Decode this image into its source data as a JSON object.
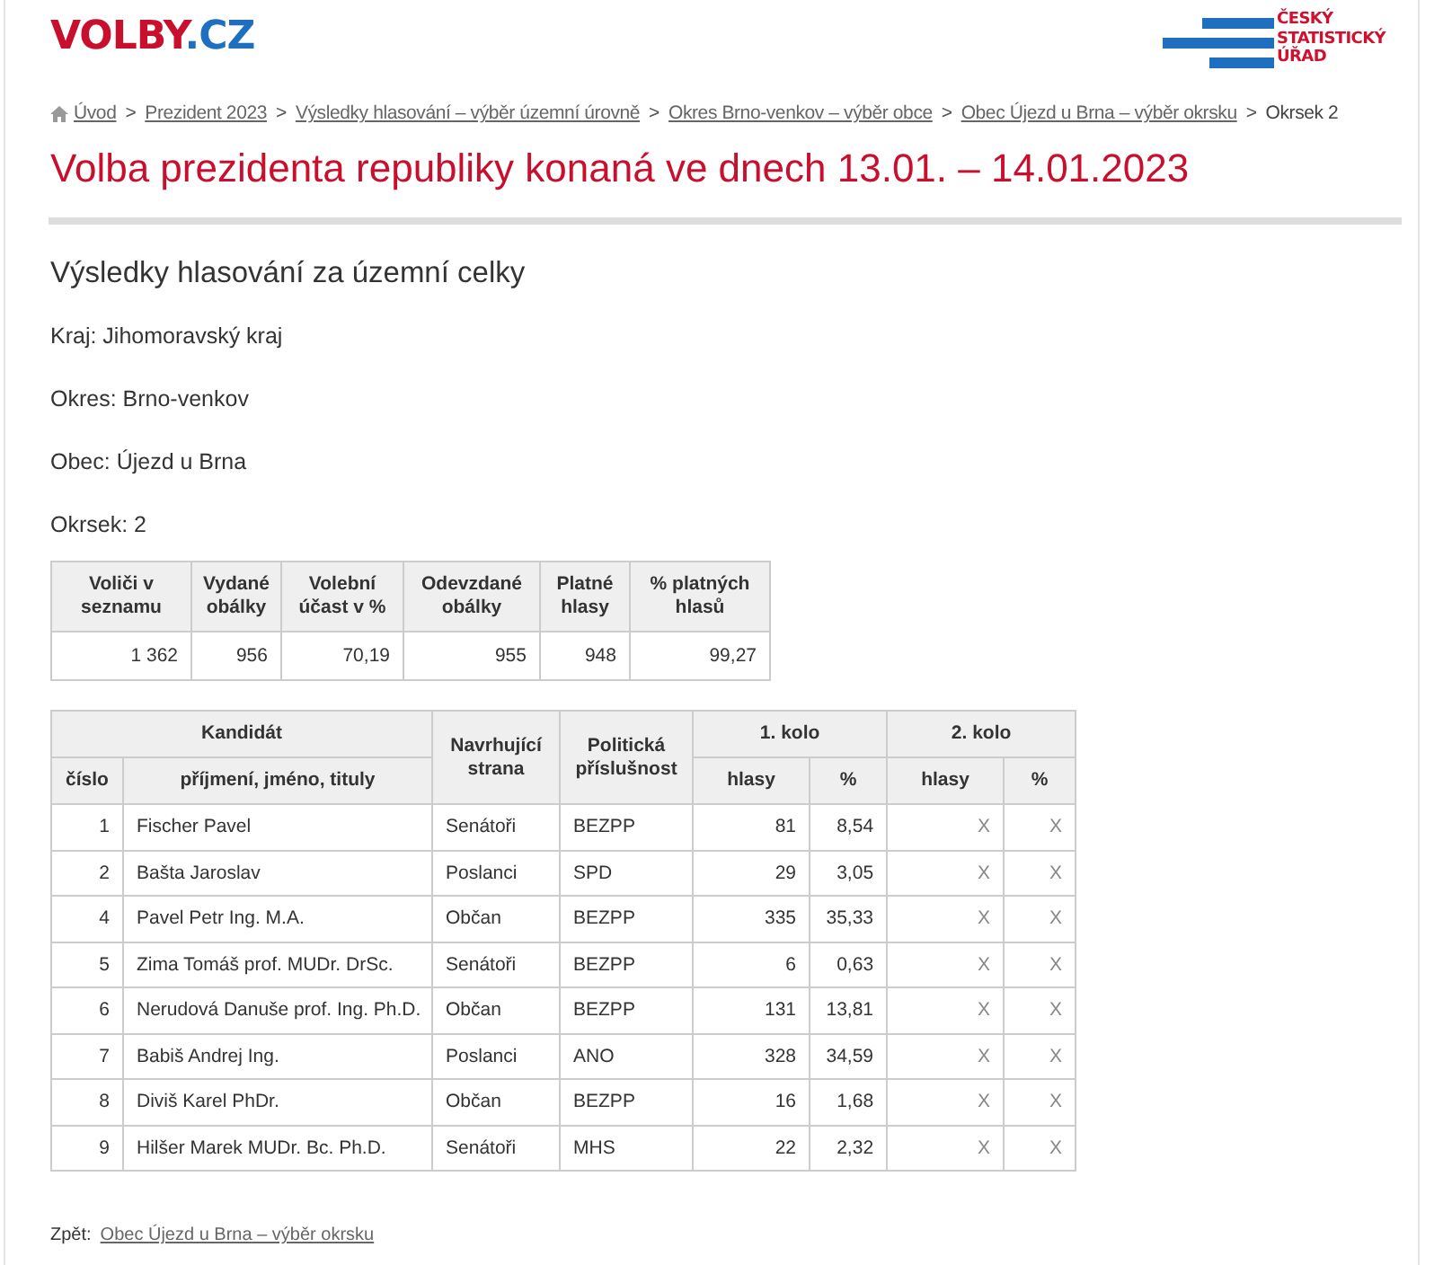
{
  "header": {
    "logo_main": "VOLBY",
    "logo_suffix": ".CZ",
    "agency_logo_lines": [
      "ČESKÝ",
      "STATISTICKÝ",
      "ÚŘAD"
    ]
  },
  "breadcrumb": {
    "separator": ">",
    "items": [
      {
        "label": "Úvod",
        "link": true
      },
      {
        "label": "Prezident 2023",
        "link": true
      },
      {
        "label": "Výsledky hlasování – výběr územní úrovně",
        "link": true
      },
      {
        "label": "Okres Brno-venkov – výběr obce",
        "link": true
      },
      {
        "label": "Obec Újezd u Brna – výběr okrsku",
        "link": true
      },
      {
        "label": "Okrsek 2",
        "link": false
      }
    ]
  },
  "title": "Volba prezidenta republiky konaná ve dnech 13.01. – 14.01.2023",
  "subtitle": "Výsledky hlasování za územní celky",
  "info_lines": [
    "Kraj: Jihomoravský kraj",
    "Okres: Brno-venkov",
    "Obec: Újezd u Brna",
    "Okrsek: 2"
  ],
  "summary_table": {
    "columns": [
      "Voliči v seznamu",
      "Vydané obálky",
      "Volební účast v %",
      "Odevzdané obálky",
      "Platné hlasy",
      "% platných hlasů"
    ],
    "values": [
      "1 362",
      "956",
      "70,19",
      "955",
      "948",
      "99,27"
    ]
  },
  "candidates_table": {
    "group_headers": [
      "Kandidát",
      "Navrhující strana",
      "Politická příslušnost",
      "1. kolo",
      "2. kolo"
    ],
    "sub_headers": [
      "číslo",
      "příjmení, jméno, tituly",
      "hlasy",
      "%",
      "hlasy",
      "%"
    ],
    "rows": [
      [
        "1",
        "Fischer Pavel",
        "Senátoři",
        "BEZPP",
        "81",
        "8,54",
        "X",
        "X"
      ],
      [
        "2",
        "Bašta Jaroslav",
        "Poslanci",
        "SPD",
        "29",
        "3,05",
        "X",
        "X"
      ],
      [
        "4",
        "Pavel Petr Ing. M.A.",
        "Občan",
        "BEZPP",
        "335",
        "35,33",
        "X",
        "X"
      ],
      [
        "5",
        "Zima Tomáš prof. MUDr. DrSc.",
        "Senátoři",
        "BEZPP",
        "6",
        "0,63",
        "X",
        "X"
      ],
      [
        "6",
        "Nerudová Danuše prof. Ing. Ph.D.",
        "Občan",
        "BEZPP",
        "131",
        "13,81",
        "X",
        "X"
      ],
      [
        "7",
        "Babiš Andrej Ing.",
        "Poslanci",
        "ANO",
        "328",
        "34,59",
        "X",
        "X"
      ],
      [
        "8",
        "Diviš Karel PhDr.",
        "Občan",
        "BEZPP",
        "16",
        "1,68",
        "X",
        "X"
      ],
      [
        "9",
        "Hilšer Marek MUDr. Bc. Ph.D.",
        "Senátoři",
        "MHS",
        "22",
        "2,32",
        "X",
        "X"
      ]
    ]
  },
  "back": {
    "label": "Zpět:",
    "link": "Obec Újezd u Brna – výběr okrsku"
  }
}
